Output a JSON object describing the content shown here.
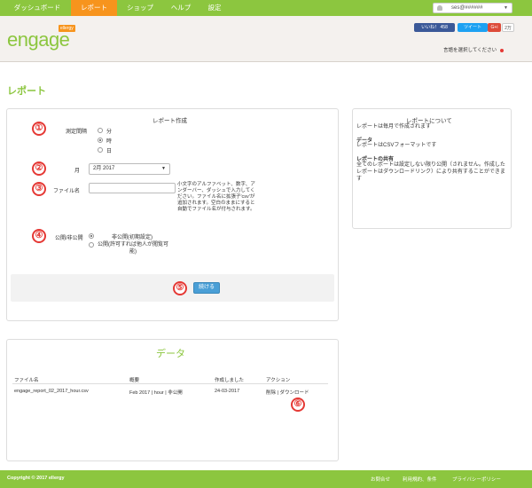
{
  "nav": {
    "items": [
      "ダッシュボード",
      "レポート",
      "ショップ",
      "ヘルプ",
      "設定"
    ],
    "active_index": 1,
    "user_name": "ses@######"
  },
  "header": {
    "logo_text": "engage",
    "logo_tag": "ellergy",
    "social": {
      "fb_label": "いいね！ 458",
      "tw_label": "ツイート",
      "gp_label": "G+i",
      "share_count": "2万"
    },
    "device_select_label": "言語を選択してください"
  },
  "page_title": "レポート",
  "report_form": {
    "title": "レポート作成",
    "interval_label": "測定間隔",
    "interval_options": [
      "分",
      "時",
      "日"
    ],
    "interval_selected": 1,
    "month_label": "月",
    "month_value": "2月 2017",
    "filename_label": "ファイル名",
    "filename_value": "",
    "filename_help": "小文字のアルファベット、数字、アンダーバー、ダッシュで入力してください。ファイル名に拡張子'csv'が追加されます。空白のままにすると自動でファイル名が付与されます。",
    "visibility_label": "公開/非公開",
    "visibility_options": [
      "非公開(初期設定)",
      "公開(許可すれば他人が閲覧可能)"
    ],
    "visibility_selected": 0,
    "continue_label": "続ける"
  },
  "annotations": [
    "①",
    "②",
    "③",
    "④",
    "⑤",
    "⑥"
  ],
  "about": {
    "title": "レポートについて",
    "intro": "レポートは毎月で作成されます",
    "data_head": "データ",
    "data_text": "レポートはCSVフォーマットです",
    "share_head": "レポートの共有",
    "share_text": "全てのレポートは設定しない限り公開（されません。作成したレポートはダウンロードリンク）により共有することができます"
  },
  "data_section": {
    "title": "データ",
    "columns": [
      "ファイル名",
      "概要",
      "作成しました",
      "アクション"
    ],
    "rows": [
      {
        "filename": "engage_report_02_2017_hour.csv",
        "summary": "Feb 2017 | hour | 非公開",
        "created": "24-03-2017",
        "delete": "削除",
        "sep": "|",
        "download": "ダウンロード"
      }
    ]
  },
  "footer": {
    "copyright": "Copyright © 2017 ellergy",
    "links": [
      "お問合せ",
      "利用規約、条件",
      "プライバシーポリシー"
    ]
  },
  "colors": {
    "brand_green": "#8cc63f",
    "active_orange": "#f7941d",
    "button_blue": "#4a9fd6",
    "annotation_red": "#e53935"
  }
}
